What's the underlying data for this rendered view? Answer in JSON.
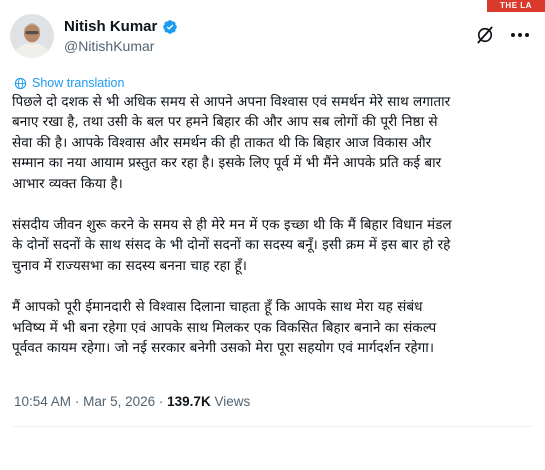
{
  "corner_badge": "THE LA",
  "author": {
    "name": "Nitish Kumar",
    "handle": "@NitishKumar",
    "verified": true,
    "avatar_icon": "person-portrait"
  },
  "translate_label": "Show translation",
  "paragraphs": [
    {
      "lines": [
        "पिछले दो दशक से भी अधिक समय से आपने अपना विश्वास एवं समर्थन मेरे साथ लगातार",
        "बनाए रखा है, तथा उसी के बल पर हमने बिहार की और आप सब लोगों की पूरी निष्ठा से",
        "सेवा की है। आपके विश्वास और समर्थन की ही ताकत थी कि बिहार आज विकास और",
        "सम्मान का नया आयाम प्रस्तुत कर रहा है। इसके लिए पूर्व में भी मैंने आपके प्रति कई बार",
        "आभार व्यक्त किया है।"
      ]
    },
    {
      "lines": [
        "संसदीय जीवन शुरू करने के समय से ही मेरे मन में एक इच्छा थी कि मैं बिहार विधान मंडल",
        "के दोनों सदनों के साथ संसद के भी दोनों सदनों का सदस्य बनूँ। इसी क्रम में इस बार हो रहे",
        "चुनाव में राज्यसभा का सदस्य बनना चाह रहा हूँ।"
      ]
    },
    {
      "lines": [
        "मैं आपको पूरी ईमानदारी से विश्वास दिलाना चाहता हूँ कि आपके साथ मेरा यह संबंध",
        "भविष्य में भी बना रहेगा एवं आपके साथ मिलकर एक विकसित बिहार बनाने का संकल्प",
        "पूर्ववत कायम रहेगा। जो नई सरकार बनेगी उसको मेरा पूरा सहयोग एवं मार्गदर्शन रहेगा।"
      ]
    }
  ],
  "meta": {
    "time": "10:54 AM",
    "separator": "·",
    "date": "Mar 5, 2026",
    "views_count": "139.7K",
    "views_label": "Views"
  },
  "colors": {
    "link": "#1d9bf0",
    "secondary": "#536471",
    "badge": "#d93a2b"
  }
}
